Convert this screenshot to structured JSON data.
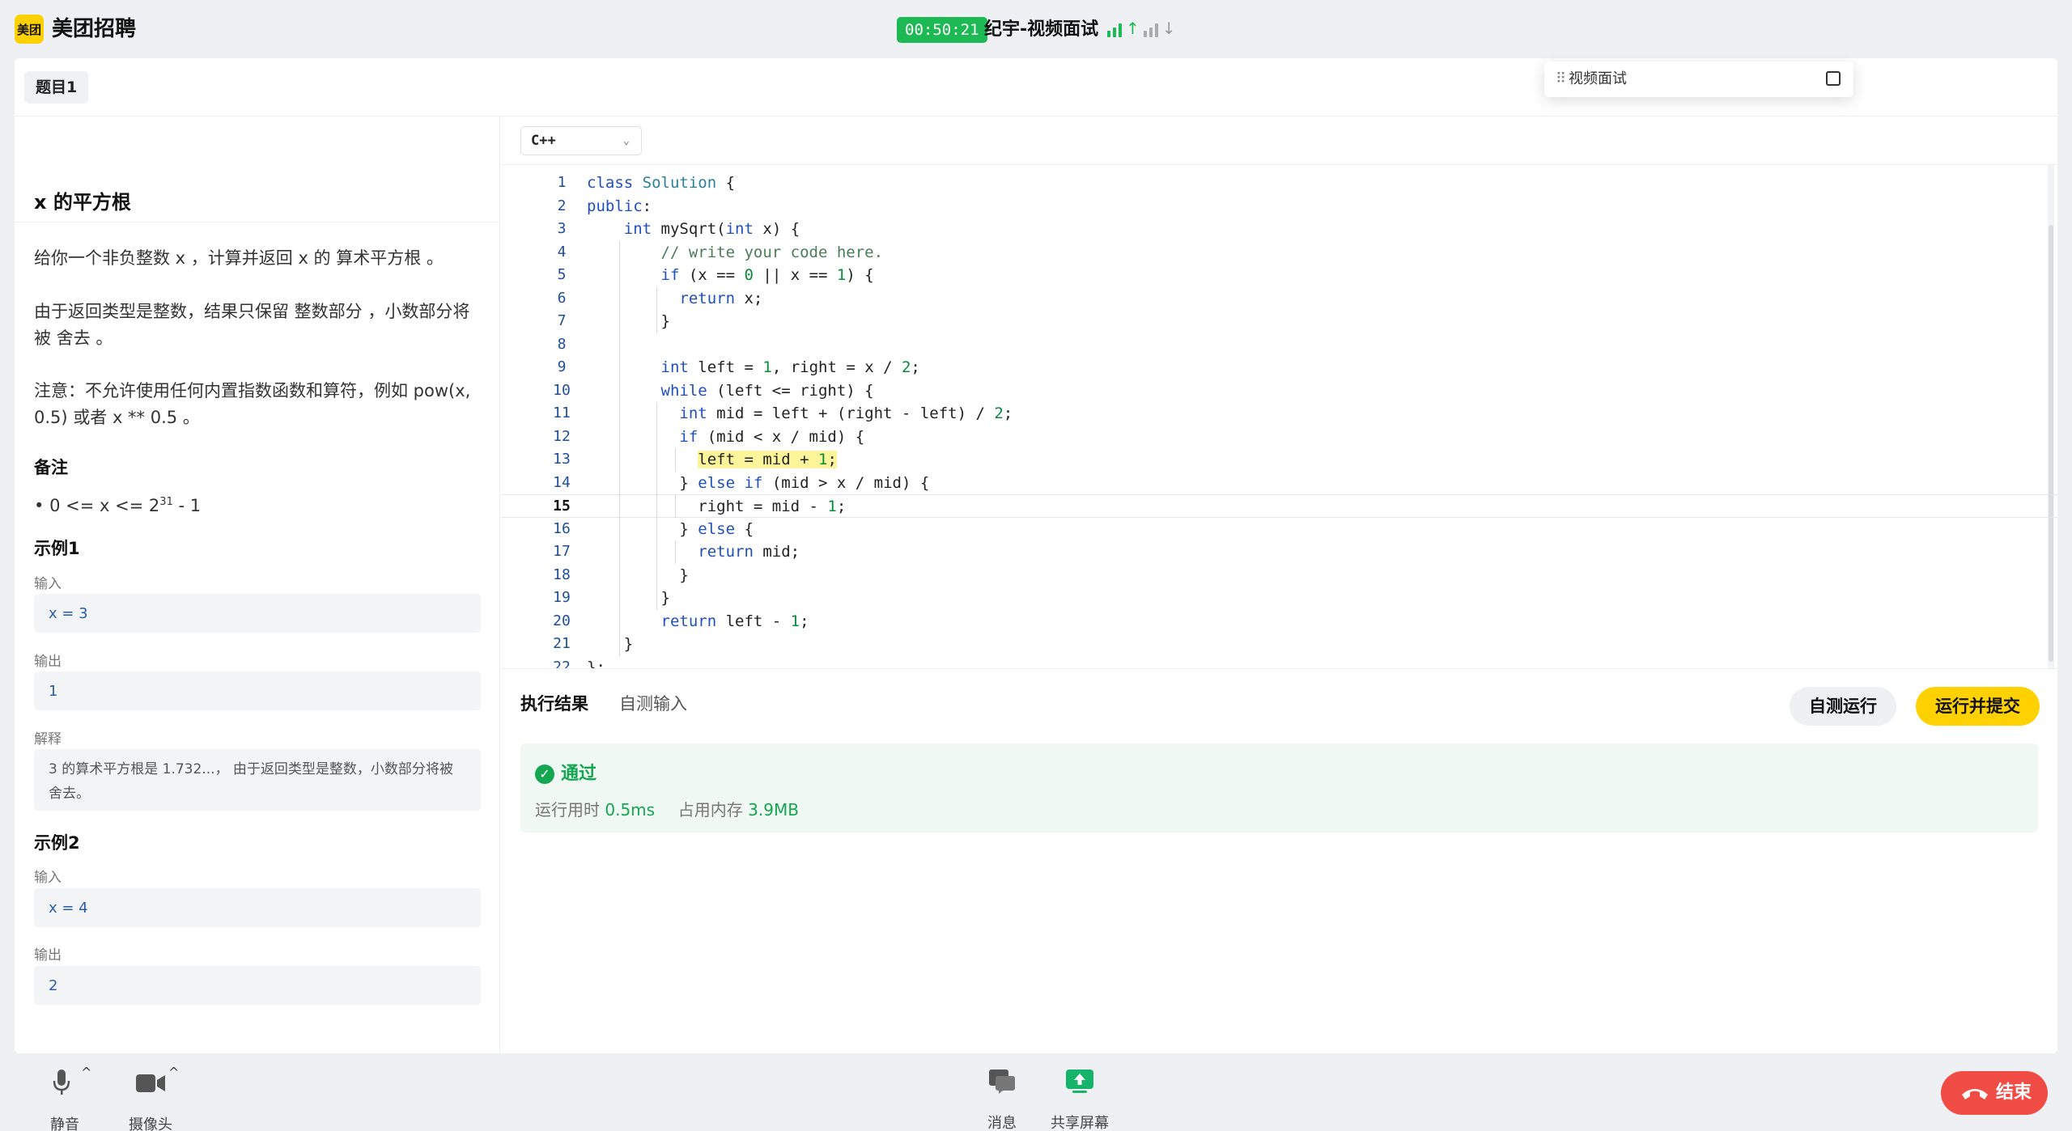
{
  "header": {
    "logo_text": "美团",
    "app_title": "美团招聘",
    "timer": "00:50:21",
    "meeting_title": "纪宇-视频面试",
    "signal_up": "↑",
    "signal_down": "↓"
  },
  "question_tab": "题目1",
  "problem": {
    "title": "x 的平方根",
    "desc1": "给你一个非负整数 x ，计算并返回 x 的 算术平方根 。",
    "desc2": "由于返回类型是整数，结果只保留 整数部分 ，小数部分将被 舍去 。",
    "desc3": "注意：不允许使用任何内置指数函数和算符，例如 pow(x, 0.5) 或者 x ** 0.5 。",
    "notes_heading": "备注",
    "constraint_prefix": "0 <= x <= 2",
    "constraint_exp": "31",
    "constraint_suffix": " - 1",
    "examples": [
      {
        "heading": "示例1",
        "input_label": "输入",
        "input": "x = 3",
        "output_label": "输出",
        "output": "1",
        "explain_label": "解释",
        "explain": "3 的算术平方根是 1.732...， 由于返回类型是整数，小数部分将被舍去。"
      },
      {
        "heading": "示例2",
        "input_label": "输入",
        "input": "x = 4",
        "output_label": "输出",
        "output": "2"
      }
    ]
  },
  "editor": {
    "language": "C++",
    "current_line": 15,
    "lines": [
      "class Solution {",
      "public:",
      "    int mySqrt(int x) {",
      "        // write your code here.",
      "        if (x == 0 || x == 1) {",
      "          return x;",
      "        }",
      "",
      "        int left = 1, right = x / 2;",
      "        while (left <= right) {",
      "          int mid = left + (right - left) / 2;",
      "          if (mid < x / mid) {",
      "            left = mid + 1;",
      "          } else if (mid > x / mid) {",
      "            right = mid - 1;",
      "          } else {",
      "            return mid;",
      "          }",
      "        }",
      "        return left - 1;",
      "    }",
      "};"
    ]
  },
  "results": {
    "tab_result": "执行结果",
    "tab_custom": "自测输入",
    "btn_self_test": "自测运行",
    "btn_run_submit": "运行并提交",
    "status": "通过",
    "runtime_label": "运行用时",
    "runtime_value": "0.5ms",
    "memory_label": "占用内存",
    "memory_value": "3.9MB"
  },
  "video_window": {
    "grip": "⠿",
    "label": "视频面试"
  },
  "bottom": {
    "mute": "静音",
    "camera": "摄像头",
    "message": "消息",
    "share_screen": "共享屏幕",
    "end": "结束"
  },
  "colors": {
    "brand_yellow": "#ffd100",
    "success_green": "#15a651",
    "end_red": "#f04b45"
  }
}
